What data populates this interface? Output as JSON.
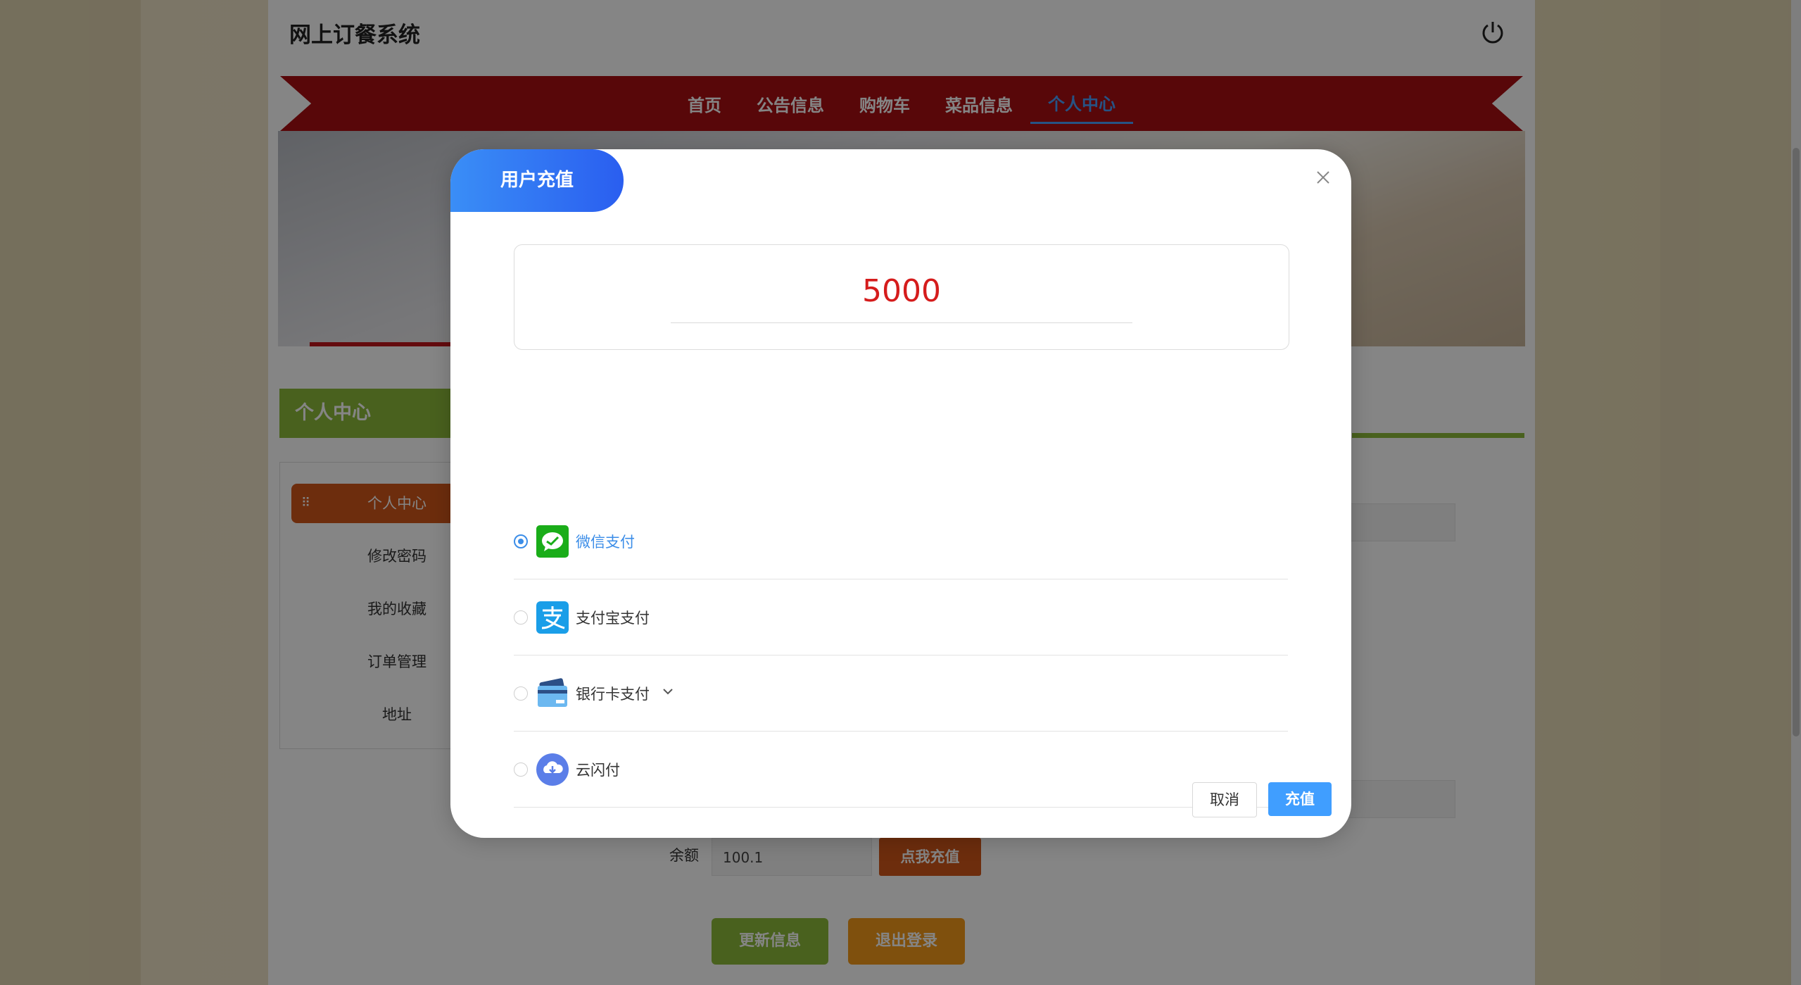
{
  "header": {
    "site_title": "网上订餐系统"
  },
  "nav": {
    "items": [
      {
        "label": "首页"
      },
      {
        "label": "公告信息"
      },
      {
        "label": "购物车"
      },
      {
        "label": "菜品信息"
      },
      {
        "label": "个人中心"
      }
    ],
    "active": "个人中心"
  },
  "sidebar": {
    "heading": "个人中心",
    "items": [
      {
        "label": "个人中心"
      },
      {
        "label": "修改密码"
      },
      {
        "label": "我的收藏"
      },
      {
        "label": "订单管理"
      },
      {
        "label": "地址"
      }
    ]
  },
  "profile": {
    "balance_label": "余额",
    "balance_value": "100.1",
    "recharge_button": "点我充值",
    "update_button": "更新信息",
    "logout_button": "退出登录"
  },
  "dialog": {
    "title": "用户充值",
    "amount": "5000",
    "payment_methods": [
      {
        "label": "微信支付",
        "icon": "wechat-pay-icon",
        "selected": true
      },
      {
        "label": "支付宝支付",
        "icon": "alipay-icon",
        "selected": false
      },
      {
        "label": "银行卡支付",
        "icon": "bank-card-icon",
        "selected": false
      },
      {
        "label": "云闪付",
        "icon": "cloud-quickpass-icon",
        "selected": false
      }
    ],
    "cancel_label": "取消",
    "confirm_label": "充值"
  },
  "colors": {
    "nav_red": "#a90f12",
    "accent_green": "#8dbb3a",
    "accent_orange": "#d1561a",
    "primary_blue": "#409eff",
    "amount_red": "#d51c1c"
  }
}
